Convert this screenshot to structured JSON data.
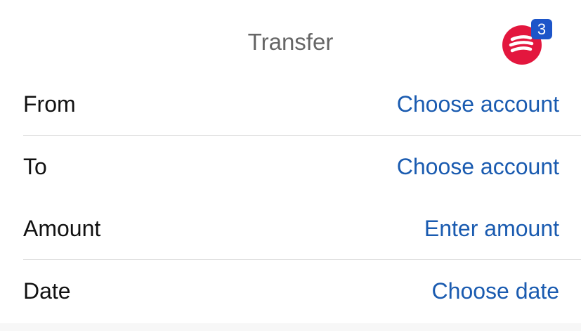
{
  "header": {
    "title": "Transfer",
    "logo_icon": "bank-logo-icon",
    "logo_color": "#e3173e",
    "badge_count": "3",
    "badge_color": "#1d55c9"
  },
  "form": {
    "rows": [
      {
        "label": "From",
        "value": "Choose account"
      },
      {
        "label": "To",
        "value": "Choose account"
      },
      {
        "label": "Amount",
        "value": "Enter amount"
      },
      {
        "label": "Date",
        "value": "Choose date"
      }
    ],
    "value_color": "#1a5bb0"
  }
}
